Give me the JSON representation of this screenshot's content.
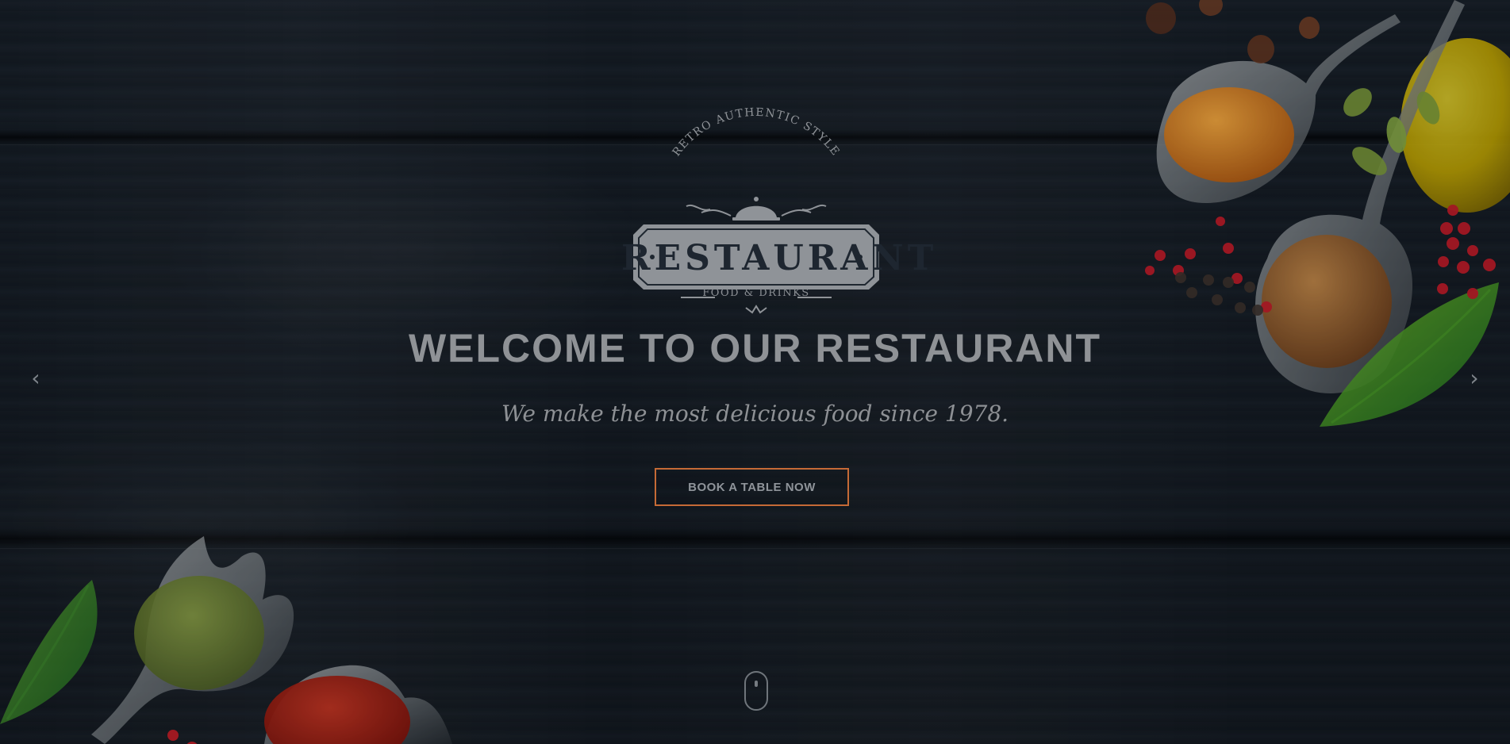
{
  "hero": {
    "logo": {
      "arched_text": "RETRO AUTHENTIC STYLE",
      "main_text": "RESTAURANT",
      "sub_text": "FOOD & DRINKS"
    },
    "title": "WELCOME TO OUR RESTAURANT",
    "subtitle": "We make the most delicious food since 1978.",
    "cta_label": "BOOK A TABLE NOW",
    "prev_arrow": "‹",
    "next_arrow": "›",
    "accent_color": "#c56a36",
    "icons": {
      "prev": "chevron-left-icon",
      "next": "chevron-right-icon",
      "scroll": "mouse-scroll-icon",
      "cloche": "cloche-icon"
    }
  }
}
